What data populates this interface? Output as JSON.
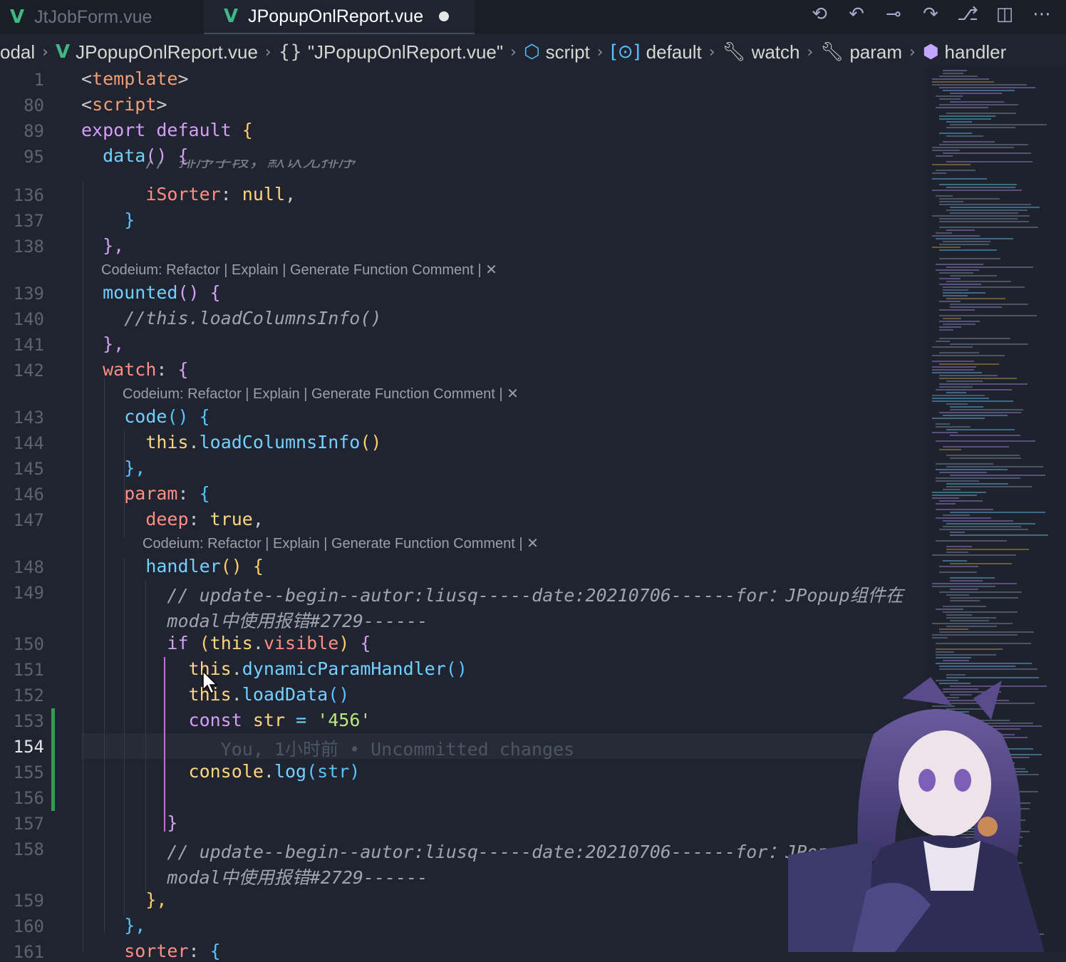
{
  "tabs": [
    {
      "label": "JtJobForm.vue",
      "active": false,
      "icon": "vue-icon"
    },
    {
      "label": "JPopupOnlReport.vue",
      "active": true,
      "icon": "vue-icon",
      "modified": true
    }
  ],
  "toolbar": {
    "icons": [
      "history-icon",
      "go-back-icon",
      "commit-icon",
      "go-forward-icon",
      "source-control-icon",
      "split-editor-icon",
      "more-icon"
    ]
  },
  "breadcrumb": [
    {
      "label": "odal",
      "icon": ""
    },
    {
      "label": "JPopupOnlReport.vue",
      "icon": "vue-icon"
    },
    {
      "label": "\"JPopupOnlReport.vue\"",
      "icon": "braces-icon"
    },
    {
      "label": "script",
      "icon": "cube-icon"
    },
    {
      "label": "default",
      "icon": "module-icon"
    },
    {
      "label": "watch",
      "icon": "wrench-icon"
    },
    {
      "label": "param",
      "icon": "wrench-icon"
    },
    {
      "label": "handler",
      "icon": "method-icon"
    }
  ],
  "lines": {
    "n1": "1",
    "n80": "80",
    "n89": "89",
    "n95": "95",
    "n136": "136",
    "n137": "137",
    "n138": "138",
    "n139": "139",
    "n140": "140",
    "n141": "141",
    "n142": "142",
    "n143": "143",
    "n144": "144",
    "n145": "145",
    "n146": "146",
    "n147": "147",
    "n148": "148",
    "n149": "149",
    "n150": "150",
    "n151": "151",
    "n152": "152",
    "n153": "153",
    "n154": "154",
    "n155": "155",
    "n156": "156",
    "n157": "157",
    "n158": "158",
    "n159": "159",
    "n160": "160",
    "n161": "161"
  },
  "code": {
    "template_open": "<",
    "template_tag": "template",
    "template_close": ">",
    "script_open": "<",
    "script_tag": "script",
    "script_close": ">",
    "export": "export",
    "default": "default",
    "brace_open": "{",
    "data_fn": "data",
    "parens": "()",
    "cut_comment": "// 排序字段，默认无排序",
    "isorter_prop": "iSorter",
    "isorter_colon": ":",
    "isorter_value": "null",
    "comma": ",",
    "close_brace": "}",
    "close_brace_comma": "},",
    "mounted_fn": "mounted",
    "mounted_comment": "//this.loadColumnsInfo()",
    "watch_prop": "watch",
    "code_fn": "code",
    "this_kw": "this",
    "dot": ".",
    "load_columns": "loadColumnsInfo",
    "param_prop": "param",
    "deep_prop": "deep",
    "true_val": "true",
    "handler_fn": "handler",
    "comment_update_1": "// update--begin--autor:liusq-----date:20210706------for：JPopup组件在",
    "comment_update_2": "modal中使用报错#2729------",
    "if_kw": "if",
    "paren_open": "(",
    "visible_prop": "visible",
    "paren_close": ")",
    "dynamic_handler": "dynamicParamHandler",
    "load_data": "loadData",
    "const_kw": "const",
    "str_var": "str",
    "eq": "=",
    "str_value": "'456'",
    "blame": "You, 1小时前 • Uncommitted changes",
    "console_obj": "console",
    "log_fn": "log",
    "str_arg": "(str)",
    "comment_end_1": "// update--begin--autor:liusq-----date:20210706------for：JPopup组件在",
    "comment_end_2": "modal中使用报错#2729------",
    "sorter_prop": "sorter"
  },
  "codelens": "Codeium: Refactor | Explain | Generate Function Comment | ✕",
  "colors": {
    "background": "#1f2430",
    "vue": "#41b883",
    "keyword": "#d59ef7",
    "function": "#73d0ff",
    "gitAdded": "#2e9e4f"
  }
}
